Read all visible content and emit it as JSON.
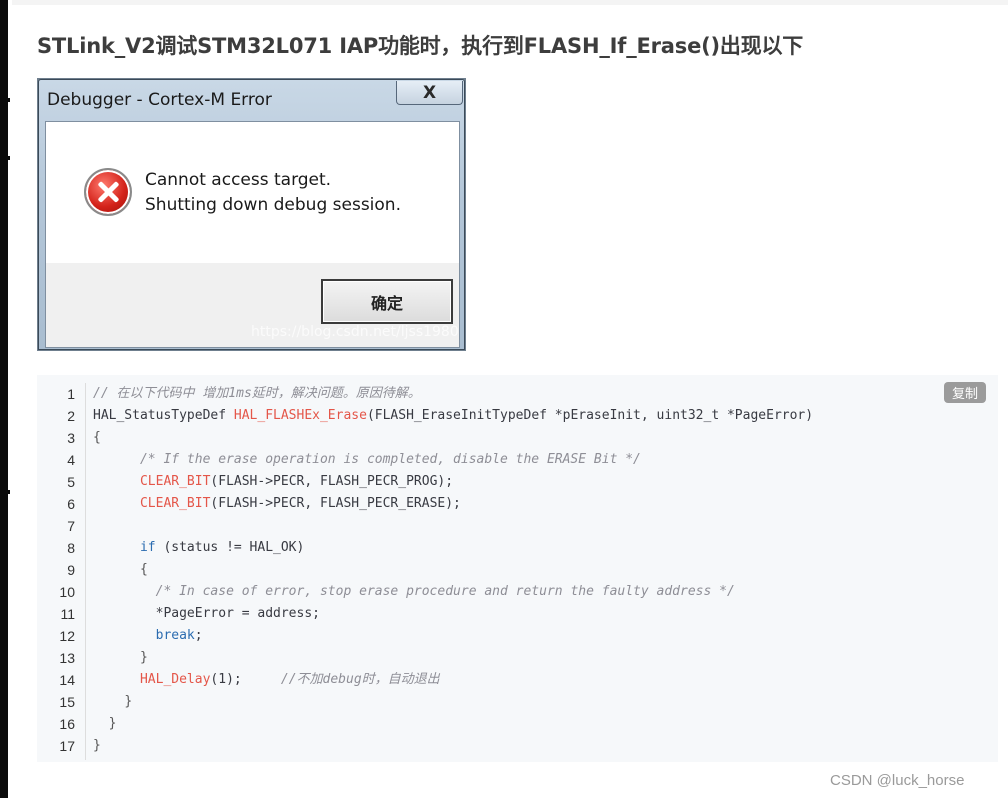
{
  "article": {
    "title": "STLink_V2调试STM32L071 IAP功能时，执行到FLASH_If_Erase()出现以下"
  },
  "dialog": {
    "title": "Debugger - Cortex-M Error",
    "close_label": "X",
    "message_line1": "Cannot access target.",
    "message_line2": "Shutting down debug session.",
    "ok_label": "确定",
    "watermark": "https://blog.csdn.net/ljss1980"
  },
  "code": {
    "copy_label": "复制",
    "line_numbers": [
      "1",
      "2",
      "3",
      "4",
      "5",
      "6",
      "7",
      "8",
      "9",
      "10",
      "11",
      "12",
      "13",
      "14",
      "15",
      "16",
      "17"
    ],
    "line1_comment": "// 在以下代码中 增加1ms延时，解决问题。原因待解。",
    "line2_type": "HAL_StatusTypeDef ",
    "line2_func": "HAL_FLASHEx_Erase",
    "line2_args": "(FLASH_EraseInitTypeDef *pEraseInit, uint32_t *PageError)",
    "line3": "{",
    "line4_comment": "/* If the erase operation is completed, disable the ERASE Bit */",
    "line5_macro": "CLEAR_BIT",
    "line5_args": "(FLASH->PECR, FLASH_PECR_PROG);",
    "line6_macro": "CLEAR_BIT",
    "line6_args": "(FLASH->PECR, FLASH_PECR_ERASE);",
    "line8_kw": "if",
    "line8_rest": " (status != HAL_OK)",
    "line9": "{",
    "line10_comment": "/* In case of error, stop erase procedure and return the faulty address */",
    "line11": "*PageError = address;",
    "line12_kw": "break",
    "line12_rest": ";",
    "line13": "}",
    "line14_func": "HAL_Delay",
    "line14_args": "(1);",
    "line14_comment": "//不加debug时，自动退出",
    "line15": "}",
    "line16": "}",
    "line17": "}"
  },
  "footer": {
    "credit": "CSDN @luck_horse"
  }
}
